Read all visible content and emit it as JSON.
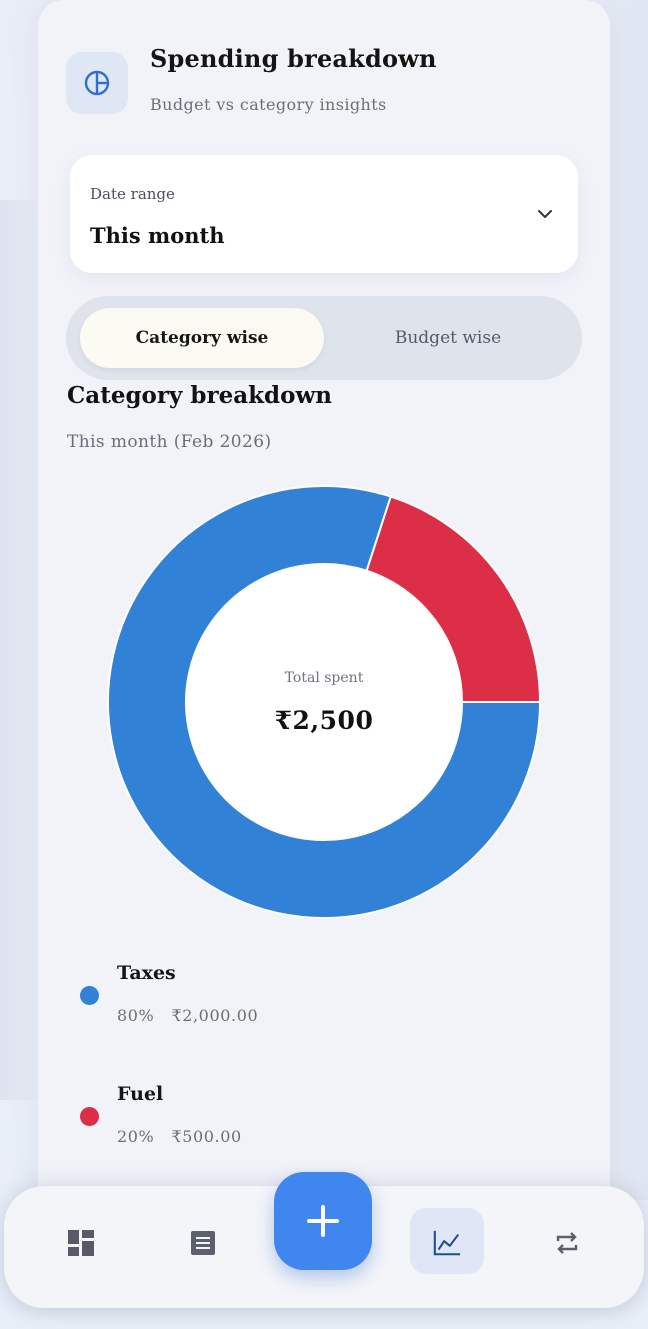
{
  "header": {
    "title": "Spending breakdown",
    "subtitle": "Budget vs category insights",
    "icon": "pie-chart-icon"
  },
  "date_range": {
    "label": "Date range",
    "value": "This month",
    "icon": "chevron-down-icon"
  },
  "segmented": {
    "tabs": [
      {
        "label": "Category wise",
        "active": true
      },
      {
        "label": "Budget wise",
        "active": false
      }
    ]
  },
  "section": {
    "title": "Category breakdown",
    "subtitle": "This month (Feb 2026)"
  },
  "donut": {
    "center_label": "Total spent",
    "center_value": "₹2,500"
  },
  "chart_data": {
    "type": "pie",
    "categories": [
      "Taxes",
      "Fuel"
    ],
    "values": [
      2000,
      500
    ],
    "percent": [
      80,
      20
    ],
    "colors": [
      "#3182d6",
      "#dd2e48"
    ],
    "donut": true
  },
  "legend": [
    {
      "name": "Taxes",
      "percent": "80%",
      "amount": "₹2,000.00",
      "color": "#3182d6"
    },
    {
      "name": "Fuel",
      "percent": "20%",
      "amount": "₹500.00",
      "color": "#dd2e48"
    }
  ],
  "bottom_nav": {
    "items": [
      {
        "icon": "dashboard-icon",
        "active": false
      },
      {
        "icon": "list-icon",
        "active": false
      },
      {
        "icon": "plus-icon",
        "active": false
      },
      {
        "icon": "chart-icon",
        "active": true
      },
      {
        "icon": "repeat-icon",
        "active": false
      }
    ],
    "accent": "#3f86ee"
  }
}
